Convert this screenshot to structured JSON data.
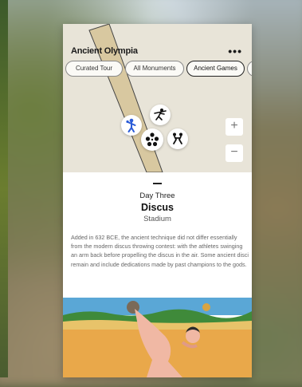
{
  "header": {
    "title": "Ancient Olympia",
    "more_icon": "more-horizontal-icon",
    "more_glyph": "•••"
  },
  "tabs": [
    {
      "label": "Curated Tour",
      "active": false
    },
    {
      "label": "All Monuments",
      "active": false
    },
    {
      "label": "Ancient Games",
      "active": true
    }
  ],
  "map": {
    "zoom_in": "+",
    "zoom_out": "−",
    "poi_icons": [
      "boxing-icon",
      "javelin-icon",
      "discus-selected-icon",
      "wrestling-icon"
    ]
  },
  "detail": {
    "day": "Day Three",
    "event": "Discus",
    "venue": "Stadium",
    "description": "Added in 632 BCE, the ancient technique did not differ essentially from the modern discus throwing contest: with the athletes swinging an arm back before propelling the discus in the air. Some ancient disci remain and include dedications made by past champions to the gods."
  },
  "colors": {
    "map_background": "#e8e4d8",
    "road_fill": "#d8c8a0",
    "accent_blue": "#2a5bd7"
  }
}
